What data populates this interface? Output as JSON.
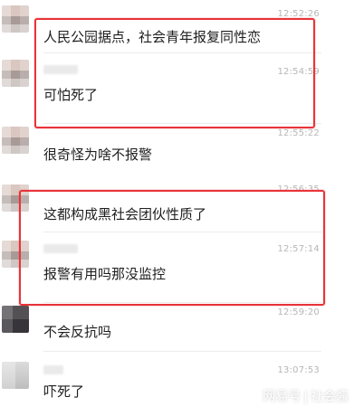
{
  "messages": [
    {
      "time": "12:52:26",
      "text": "人民公园据点，社会青年报复同性恋"
    },
    {
      "time": "12:54:59",
      "text": "可怕死了"
    },
    {
      "time": "12:55:22",
      "text": "很奇怪为啥不报警"
    },
    {
      "time": "12:56:35",
      "text": "这都构成黑社会团伙性质了"
    },
    {
      "time": "12:57:14",
      "text": "报警有用吗那没监控"
    },
    {
      "time": "12:59:20",
      "text": "不会反抗吗"
    },
    {
      "time": "13:07:53",
      "text": "吓死了"
    }
  ],
  "watermark": {
    "brand": "网易号",
    "separator": "|",
    "author": "社会酱"
  },
  "colors": {
    "highlight": "#e8343a",
    "time": "#b6b6b6",
    "text": "#1e1e1e"
  }
}
